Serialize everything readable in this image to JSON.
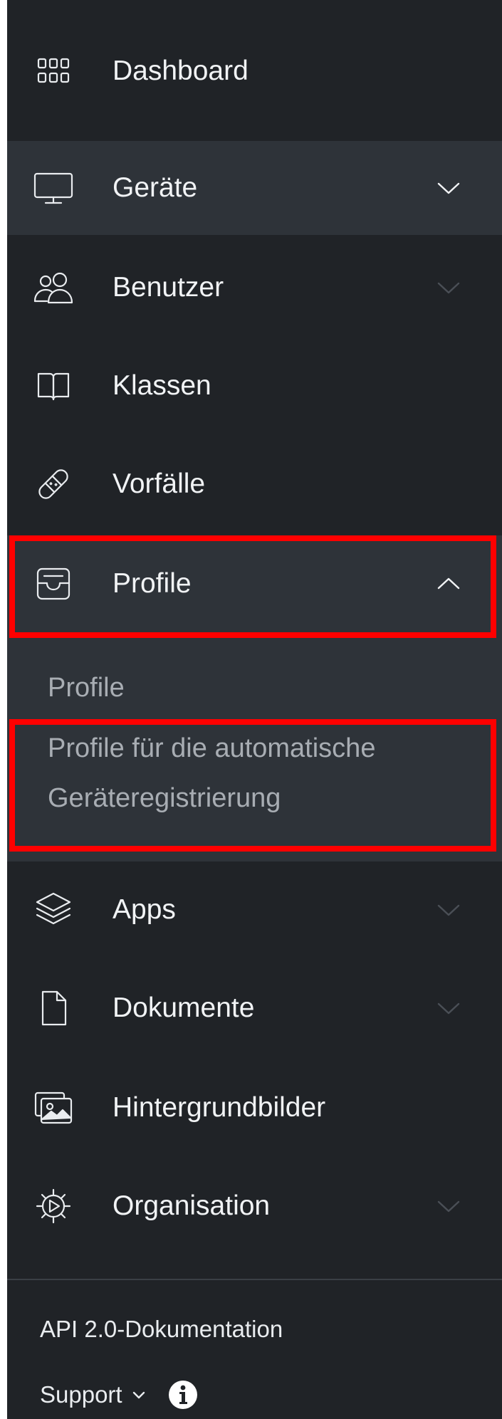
{
  "sidebar": {
    "items": [
      {
        "label": "Dashboard",
        "icon": "grid-icon"
      },
      {
        "label": "Geräte",
        "icon": "monitor-icon"
      },
      {
        "label": "Benutzer",
        "icon": "users-icon"
      },
      {
        "label": "Klassen",
        "icon": "book-icon"
      },
      {
        "label": "Vorfälle",
        "icon": "bandage-icon"
      },
      {
        "label": "Profile",
        "icon": "inbox-icon"
      },
      {
        "label": "Apps",
        "icon": "layers-icon"
      },
      {
        "label": "Dokumente",
        "icon": "document-icon"
      },
      {
        "label": "Hintergrundbilder",
        "icon": "images-icon"
      },
      {
        "label": "Organisation",
        "icon": "settings-icon"
      }
    ],
    "profile_submenu": [
      {
        "label": "Profile"
      },
      {
        "label": "Profile für die automatische Geräteregistrierung"
      }
    ],
    "footer": {
      "api_docs_label": "API 2.0-Dokumentation",
      "support_label": "Support"
    }
  },
  "colors": {
    "sidebar_bg": "#202327",
    "active_bg": "#2e3339",
    "highlight": "#ff0000",
    "text": "#f1f3f5",
    "submenu_text": "#a8adb3"
  }
}
